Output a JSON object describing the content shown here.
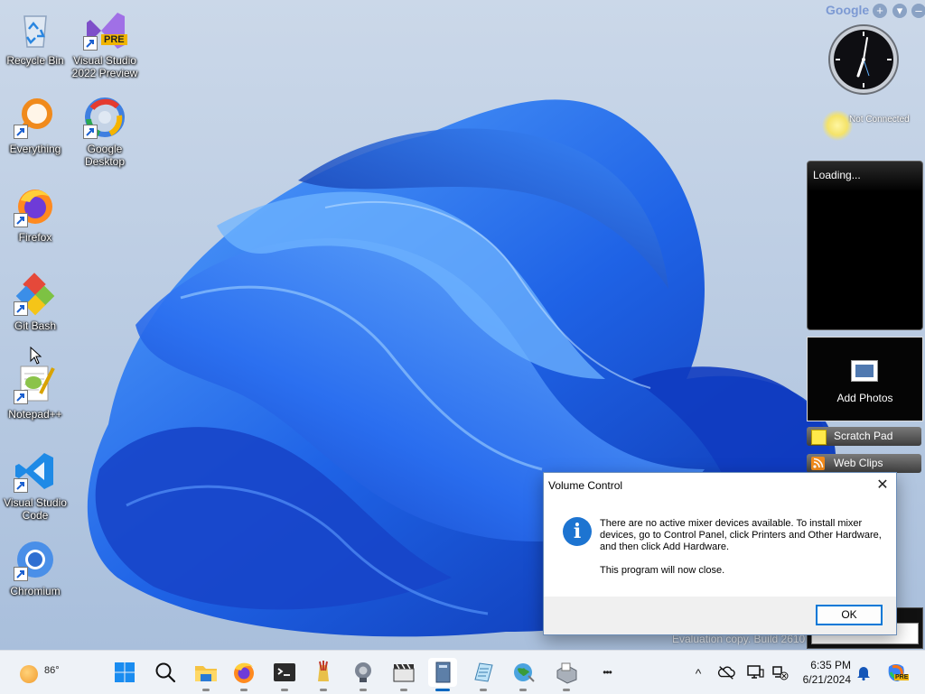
{
  "desktop": {
    "icons": [
      {
        "label": "Recycle Bin"
      },
      {
        "label": "Visual Studio 2022 Preview",
        "badge": "PRE"
      },
      {
        "label": "Everything"
      },
      {
        "label": "Google Desktop"
      },
      {
        "label": "Firefox"
      },
      {
        "label": "Git Bash"
      },
      {
        "label": "Notepad++"
      },
      {
        "label": "Visual Studio Code"
      },
      {
        "label": "Chromium"
      }
    ],
    "evaluation_text": "Evaluation copy. Build 2610"
  },
  "gadgets": {
    "brand": "Google",
    "add_symbol": "+",
    "menu_symbol": "▾",
    "minimize_symbol": "–",
    "clock_time": "6:35",
    "network_status": "Not Connected",
    "news_loading": "Loading...",
    "photos_label": "Add Photos",
    "scratch_pad_label": "Scratch Pad",
    "web_clips_label": "Web Clips"
  },
  "dialog": {
    "title": "Volume Control",
    "close_symbol": "✕",
    "info_symbol": "i",
    "message": "There are no active mixer devices available. To install mixer devices, go to Control Panel, click Printers and Other Hardware, and then click Add Hardware.",
    "message2": "This program will now close.",
    "ok_label": "OK"
  },
  "taskbar": {
    "weather_temp": "86°",
    "apps": [
      "start",
      "search",
      "file-explorer",
      "firefox",
      "terminal",
      "paint-brush",
      "speaker",
      "clapperboard",
      "notebook",
      "notepad",
      "globe",
      "printer"
    ],
    "more_symbol": "•••",
    "tray_chevron": "^",
    "time": "6:35 PM",
    "date": "6/21/2024",
    "copilot_badge": "PRE"
  },
  "colors": {
    "accent": "#0067c0",
    "dialog_border": "#6b8db8",
    "info_blue": "#1d74d1",
    "wallpaper_blue": "#1f63e6"
  }
}
